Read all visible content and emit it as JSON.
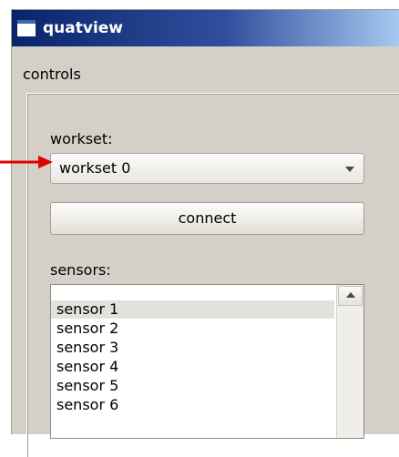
{
  "window": {
    "title": "quatview"
  },
  "controls": {
    "group_title": "controls",
    "workset_label": "workset:",
    "workset_selected": "workset 0",
    "connect_label": "connect",
    "sensors_label": "sensors:",
    "sensors": [
      "sensor 1",
      "sensor 2",
      "sensor 3",
      "sensor 4",
      "sensor 5",
      "sensor 6"
    ],
    "selected_sensor": "sensor 1"
  },
  "colors": {
    "titlebar_start": "#0a246a",
    "titlebar_end": "#a6caf0",
    "window_bg": "#d4d0c8",
    "annotation_arrow": "#e00000"
  },
  "icons": {
    "app": "window-icon",
    "combo_dropdown": "chevron-down-icon",
    "scroll_up": "scroll-up-icon",
    "annotation": "arrow-right-icon"
  }
}
